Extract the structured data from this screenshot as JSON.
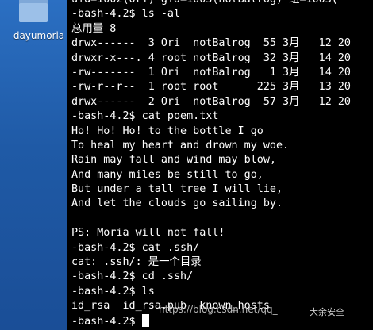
{
  "desktop": {
    "icon_label": "dayumoria",
    "icon_name": "folder-icon"
  },
  "terminal": {
    "lines": [
      "uid=1002(Ori) gid=1003(notBalrog) 组=1003(",
      "-bash-4.2$ ls -al",
      "总用量 8",
      "drwx------  3 Ori  notBalrog  55 3月   12 20",
      "drwxr-x---. 4 root notBalrog  32 3月   14 20",
      "-rw-------  1 Ori  notBalrog   1 3月   14 20",
      "-rw-r--r--  1 root root      225 3月   13 20",
      "drwx------  2 Ori  notBalrog  57 3月   12 20",
      "-bash-4.2$ cat poem.txt",
      "Ho! Ho! Ho! to the bottle I go",
      "To heal my heart and drown my woe.",
      "Rain may fall and wind may blow,",
      "And many miles be still to go,",
      "But under a tall tree I will lie,",
      "And let the clouds go sailing by.",
      "",
      "PS: Moria will not fall!",
      "-bash-4.2$ cat .ssh/",
      "cat: .ssh/: 是一个目录",
      "-bash-4.2$ cd .ssh/",
      "-bash-4.2$ ls",
      "id_rsa  id_rsa.pub  known_hosts"
    ],
    "prompt": "-bash-4.2$ "
  },
  "watermark": {
    "url": "https://blog.csdn.net/qq_",
    "brand": "大余安全"
  },
  "colors": {
    "terminal_bg": "#000000",
    "terminal_fg": "#ffffff",
    "desktop_bg": "#1f5aa6"
  }
}
